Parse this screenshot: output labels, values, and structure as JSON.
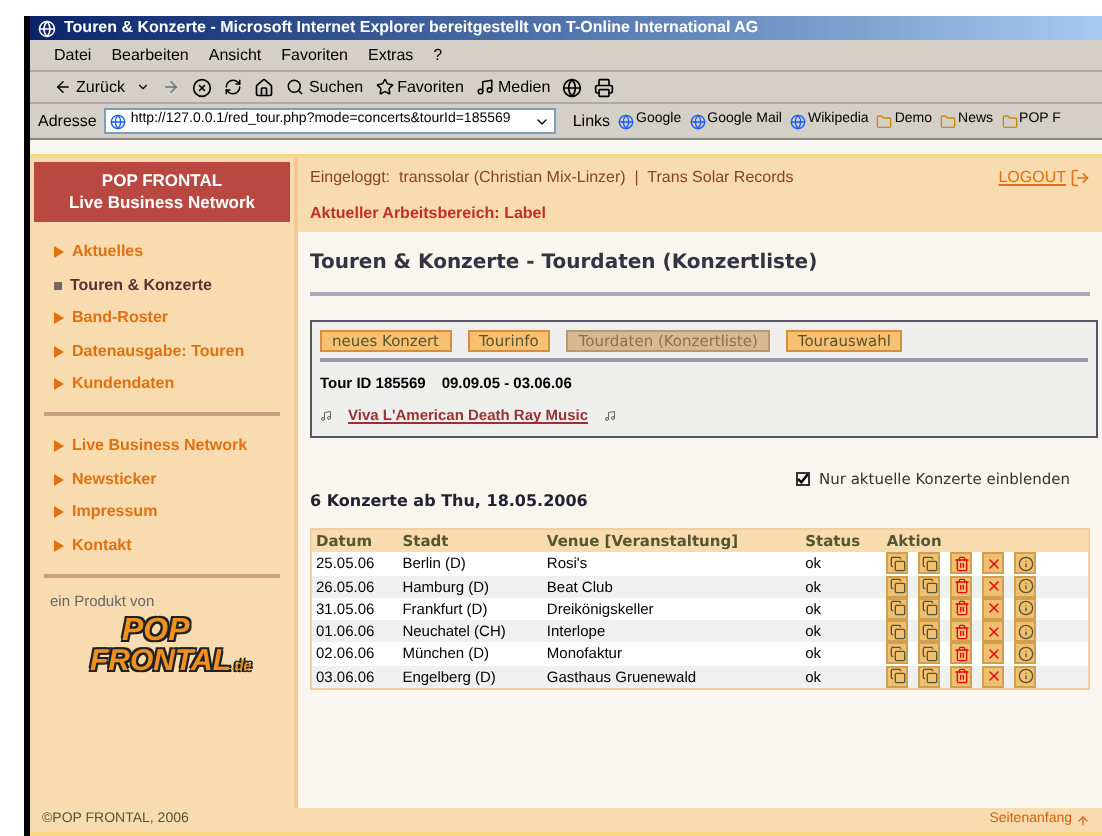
{
  "window": {
    "title": "Touren & Konzerte - Microsoft Internet Explorer bereitgestellt von T-Online International AG"
  },
  "menu": [
    "Datei",
    "Bearbeiten",
    "Ansicht",
    "Favoriten",
    "Extras",
    "?"
  ],
  "toolbar": {
    "back": "Zurück",
    "search": "Suchen",
    "favorites": "Favoriten",
    "media": "Medien"
  },
  "address": {
    "label": "Adresse",
    "value": "http://127.0.0.1/red_tour.php?mode=concerts&tourId=185569"
  },
  "links": {
    "label": "Links",
    "items": [
      {
        "label": "Google",
        "kind": "page"
      },
      {
        "label": "Google Mail",
        "kind": "page"
      },
      {
        "label": "Wikipedia",
        "kind": "page"
      },
      {
        "label": "Demo",
        "kind": "folder"
      },
      {
        "label": "News",
        "kind": "folder"
      },
      {
        "label": "POP F",
        "kind": "folder"
      }
    ]
  },
  "sidebar": {
    "header": [
      "POP FRONTAL",
      "Live Business Network"
    ],
    "groups": [
      [
        {
          "label": "Aktuelles",
          "selected": false
        },
        {
          "label": "Touren & Konzerte",
          "selected": true
        },
        {
          "label": "Band-Roster",
          "selected": false
        },
        {
          "label": "Datenausgabe: Touren",
          "selected": false
        },
        {
          "label": "Kundendaten",
          "selected": false
        }
      ],
      [
        {
          "label": "Live Business Network",
          "selected": false
        },
        {
          "label": "Newsticker",
          "selected": false
        },
        {
          "label": "Impressum",
          "selected": false
        },
        {
          "label": "Kontakt",
          "selected": false
        }
      ]
    ],
    "product_label": "ein Produkt von",
    "logo": [
      "POP",
      "FRONTAL",
      ".de"
    ]
  },
  "topbar": {
    "logged_in": "Eingeloggt:  transsolar (Christian Mix-Linzer)  |  Trans Solar Records",
    "workspace": "Aktueller Arbeitsbereich: Label",
    "logout": "LOGOUT"
  },
  "heading": "Touren & Konzerte - Tourdaten (Konzertliste)",
  "tabs": [
    {
      "label": "neues Konzert",
      "selected": false
    },
    {
      "label": "Tourinfo",
      "selected": false
    },
    {
      "label": "Tourdaten (Konzertliste)",
      "selected": true
    },
    {
      "label": "Tourauswahl",
      "selected": false
    }
  ],
  "tour": {
    "id": "Tour ID 185569",
    "dates": "09.09.05 - 03.06.06",
    "name": "Viva L'American Death Ray Music"
  },
  "filter": {
    "label": "Nur aktuelle Konzerte einblenden",
    "checked": true
  },
  "count_title": "6 Konzerte ab Thu, 18.05.2006",
  "table": {
    "columns": [
      "Datum",
      "Stadt",
      "Venue [Veranstaltung]",
      "Status",
      "Aktion"
    ],
    "rows": [
      [
        "25.05.06",
        "Berlin (D)",
        "Rosi's",
        "ok"
      ],
      [
        "26.05.06",
        "Hamburg (D)",
        "Beat Club",
        "ok"
      ],
      [
        "31.05.06",
        "Frankfurt (D)",
        "Dreikönigskeller",
        "ok"
      ],
      [
        "01.06.06",
        "Neuchatel (CH)",
        "Interlope",
        "ok"
      ],
      [
        "02.06.06",
        "München (D)",
        "Monofaktur",
        "ok"
      ],
      [
        "03.06.06",
        "Engelberg (D)",
        "Gasthaus Gruenewald",
        "ok"
      ]
    ]
  },
  "footer": {
    "copyright": "©POP FRONTAL, 2006",
    "top_link": "Seitenanfang"
  }
}
